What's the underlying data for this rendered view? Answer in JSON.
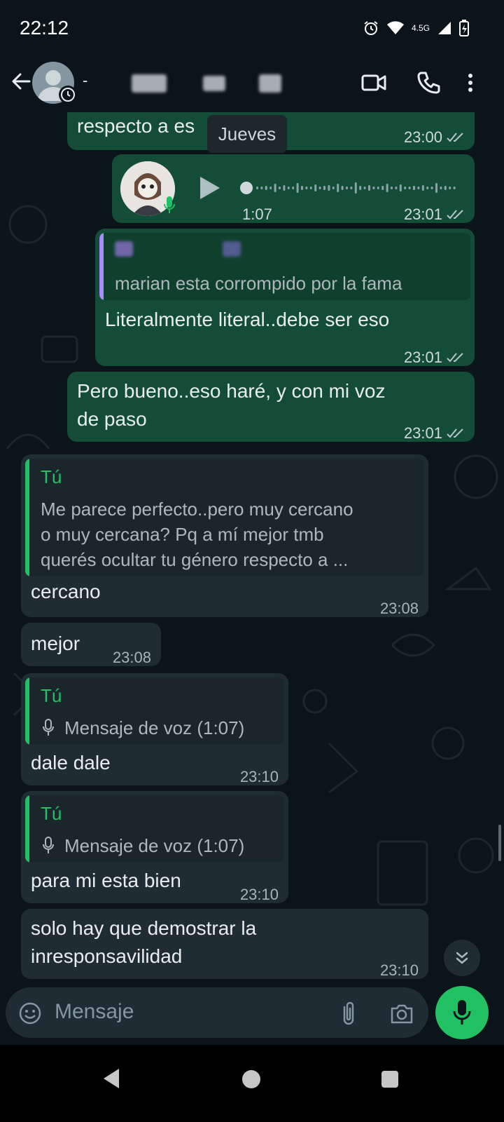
{
  "status": {
    "time": "22:12",
    "network": "4.5G"
  },
  "header": {
    "contact_name": "-"
  },
  "day_chip": "Jueves",
  "messages": [
    {
      "text": "respecto a es",
      "time": "23:00"
    },
    {
      "duration": "1:07",
      "time": "23:01"
    },
    {
      "quote_text": "marian esta corrompido por la fama",
      "text": "Literalmente literal..debe ser eso",
      "time": "23:01"
    },
    {
      "line1": "Pero bueno..eso haré, y con mi voz",
      "line2": "de paso",
      "time": "23:01"
    },
    {
      "quote_name": "Tú",
      "quote_line1": "Me parece perfecto..pero muy cercano",
      "quote_line2": "o muy cercana? Pq a mí mejor tmb",
      "quote_line3": "querés ocultar tu género respecto a ...",
      "text": "cercano",
      "time": "23:08"
    },
    {
      "text": "mejor",
      "time": "23:08"
    },
    {
      "quote_name": "Tú",
      "quote_text": "Mensaje de voz (1:07)",
      "text": "dale dale",
      "time": "23:10"
    },
    {
      "quote_name": "Tú",
      "quote_text": "Mensaje de voz (1:07)",
      "text": "para mi esta bien",
      "time": "23:10"
    },
    {
      "line1": "solo hay que demostrar la",
      "line2": "inresponsavilidad",
      "time": "23:10"
    }
  ],
  "composer": {
    "placeholder": "Mensaje"
  },
  "colors": {
    "outgoing": "#144d37",
    "incoming": "#1f2c34",
    "accent": "#21c063",
    "background": "#0b141a"
  }
}
